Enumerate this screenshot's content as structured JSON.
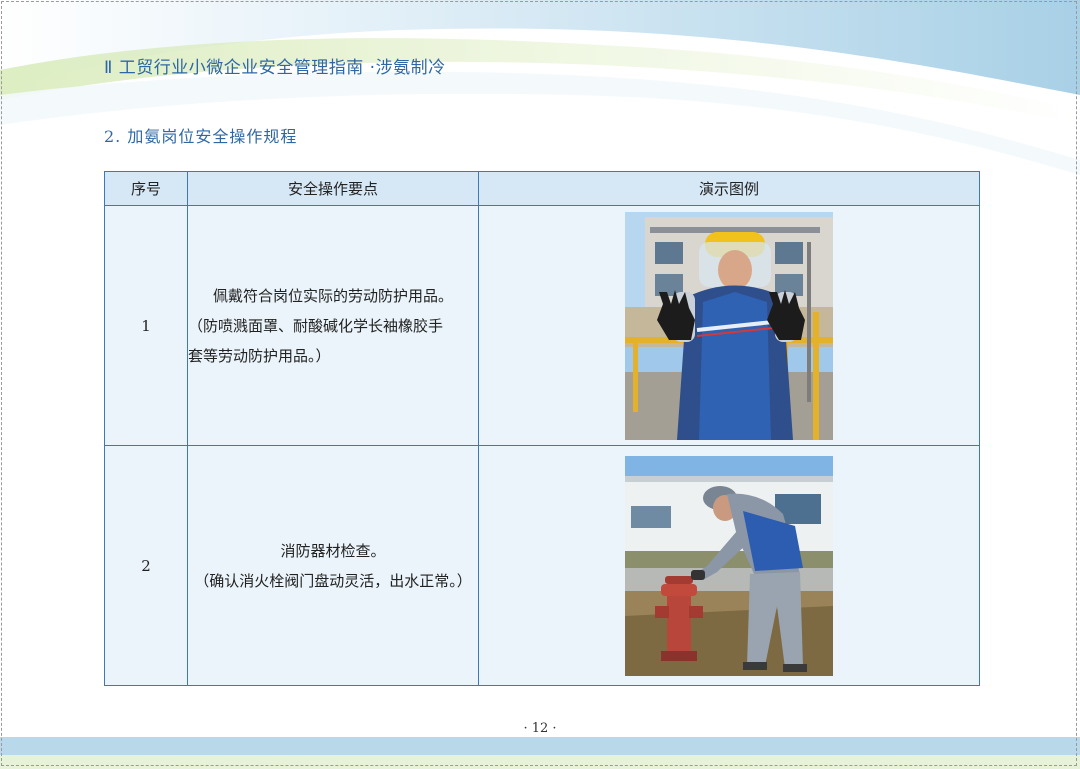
{
  "header": {
    "title": "Ⅱ 工贸行业小微企业安全管理指南 ·涉氨制冷"
  },
  "section": {
    "title": "2. 加氨岗位安全操作规程"
  },
  "table": {
    "headers": [
      "序号",
      "安全操作要点",
      "演示图例"
    ],
    "rows": [
      {
        "num": "1",
        "lines": [
          "佩戴符合岗位实际的劳动防护用品。",
          "（防喷溅面罩、耐酸碱化学长袖橡胶手",
          "套等劳动防护用品。）"
        ],
        "photo": "worker-wearing-face-shield-and-gloves"
      },
      {
        "num": "2",
        "lines": [
          "消防器材检查。",
          "（确认消火栓阀门盘动灵活，出水正常。）"
        ],
        "photo": "worker-checking-fire-hydrant"
      }
    ]
  },
  "footer": {
    "page": "· 12 ·"
  },
  "colors": {
    "accent": "#2f67a6",
    "table_border": "#3d78b8",
    "table_bg": "#ebf4fb",
    "header_bg": "#d6e8f6"
  }
}
